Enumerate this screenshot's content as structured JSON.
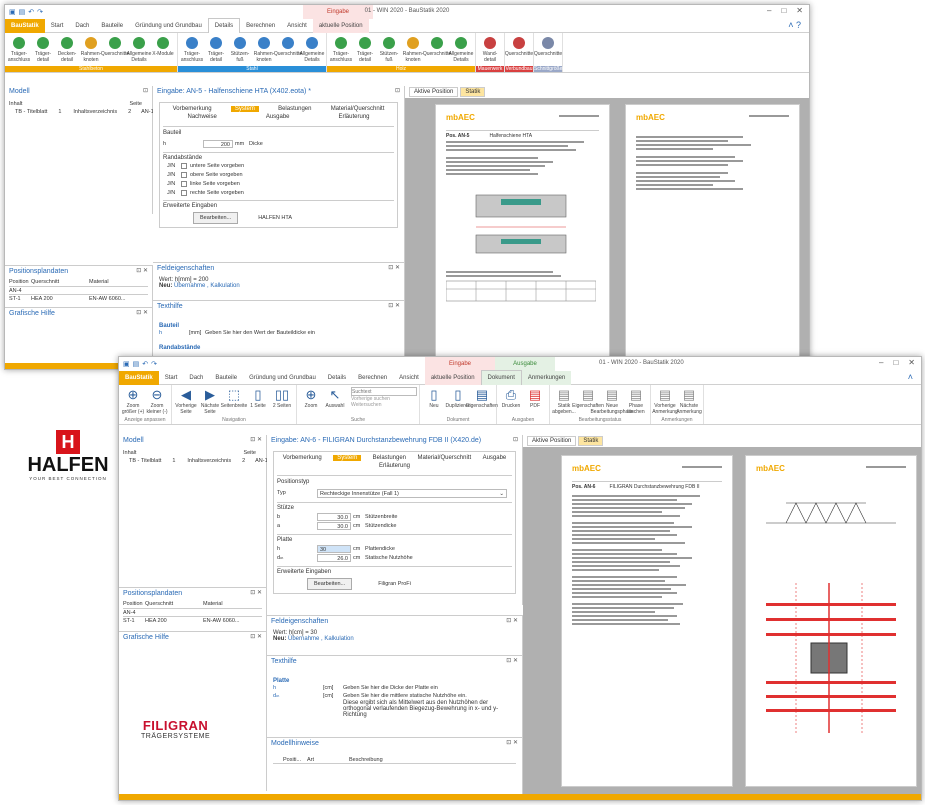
{
  "back": {
    "title": "01 - WIN 2020 - BauStatik 2020",
    "ctx_tab": {
      "line1": "Eingabe",
      "line2": "aktuelle Position"
    },
    "tabs": [
      "BauStatik",
      "Start",
      "Dach",
      "Bauteile",
      "Gründung und Grundbau",
      "Details",
      "Berechnen",
      "Ansicht"
    ],
    "ribbon_groups": [
      {
        "label": "Stahlbeton",
        "color": "#f0a800",
        "buttons": [
          "Träger-anschluss",
          "Träger-detail",
          "Decken-detail",
          "Rahmen-knoten",
          "Querschnitte",
          "Allgemeine Details",
          "X-Module"
        ]
      },
      {
        "label": "Stahl",
        "color": "#2a8fd8",
        "buttons": [
          "Träger-anschluss",
          "Träger-detail",
          "Stützen-fuß",
          "Rahmen-knoten",
          "Querschnitte",
          "Allgemeine Details"
        ]
      },
      {
        "label": "Holz",
        "color": "#f0a800",
        "buttons": [
          "Träger-anschluss",
          "Träger-detail",
          "Stützen-fuß",
          "Rahmen-knoten",
          "Querschnitte",
          "Allgemeine Details"
        ]
      },
      {
        "label": "Mauerwerk",
        "color": "#d94040",
        "buttons": [
          "Wand-detail"
        ]
      },
      {
        "label": "Verbundbau",
        "color": "#d94040",
        "buttons": [
          "Querschnitte"
        ]
      },
      {
        "label": "Schnittgrößen",
        "color": "#9aa8c8",
        "buttons": [
          "Querschnitte"
        ]
      }
    ],
    "model_title": "Modell",
    "model_cols": [
      "Inhalt",
      "Seite"
    ],
    "model_items": [
      {
        "t": "TB - Titelblatt",
        "p": "1"
      },
      {
        "t": "Inhaltsverzeichnis",
        "p": "2"
      },
      {
        "t": "AN-1* - Stahl-Schweißnahtnac...",
        "p": "3"
      },
      {
        "t": "AN-2* - Stahlbeton Eck-Knoten",
        "p": "5"
      },
      {
        "t": "AN-3* - Werkstoffe erzeugen",
        "p": "8"
      },
      {
        "t": "AN-4* - Brandschutzbeikledun...",
        "p": "9"
      },
      {
        "t": "ST-1* - Aluminium-Stütze",
        "p": "10"
      },
      {
        "t": "AN-5* - Halfenschiene HTA",
        "p": "13"
      }
    ],
    "plan_title": "Positionsplandaten",
    "plan_cols": [
      "Position",
      "Querschnitt",
      "Material"
    ],
    "plan_rows": [
      [
        "AN-4",
        "",
        ""
      ],
      [
        "ST-1",
        "HEA 200",
        "EN-AW 6060..."
      ]
    ],
    "help_title": "Grafische Hilfe",
    "input_title": "Eingabe: AN-5 - Halfenschiene HTA (X402.eota) *",
    "input_tabs": [
      "Vorbemerkung",
      "System",
      "Belastungen",
      "Material/Querschnitt",
      "Nachweise",
      "Ausgabe",
      "Erläuterung"
    ],
    "bauteil": "Bauteil",
    "h_label": "h",
    "h_value": "200",
    "h_unit": "mm",
    "h_desc": "Dicke",
    "rand": "Randabstände",
    "rand_rows": [
      [
        "J/N",
        "untere Seite vorgeben"
      ],
      [
        "J/N",
        "obere Seite vorgeben"
      ],
      [
        "J/N",
        "linke Seite vorgeben"
      ],
      [
        "J/N",
        "rechte Seite vorgeben"
      ]
    ],
    "ext": "Erweiterte Eingaben",
    "edit_btn": "Bearbeiten...",
    "ext_val": "HALFEN HTA",
    "field_title": "Feldeigenschaften",
    "field_val": "Wert: h[mm] = 200",
    "field_new": "Neu:",
    "field_links": "Übernahme , Kalkulation",
    "text_title": "Texthilfe",
    "text_key": "Bauteil",
    "text_h": "h",
    "text_unit": "[mm]",
    "text_desc": "Geben Sie hier den Wert der Bauteildicke ein",
    "text_rand": "Randabstände",
    "doc_tabs": [
      "Aktive Position",
      "Statik"
    ],
    "doc_heading": "Pos. AN-5",
    "doc_sub": "Halfenschiene HTA",
    "logo_brand": "mbAEC",
    "halfen": "HALFEN",
    "halfen_sub": "YOUR BEST CONNECTION"
  },
  "front": {
    "title": "01 - WIN 2020 - BauStatik 2020",
    "ctx1": {
      "line1": "Eingabe",
      "line2": "aktuelle Position"
    },
    "ctx2": {
      "line1": "Ausgabe",
      "line2": "Dokument"
    },
    "tabs": [
      "BauStatik",
      "Start",
      "Dach",
      "Bauteile",
      "Gründung und Grundbau",
      "Details",
      "Berechnen",
      "Ansicht",
      "aktuelle Position",
      "Dokument",
      "Anmerkungen"
    ],
    "ribbon": [
      {
        "label": "Anzeige anpassen",
        "buttons": [
          "Zoom größer (+)",
          "Zoom kleiner (-)"
        ]
      },
      {
        "label": "Navigation",
        "buttons": [
          "Vorherige Seite",
          "Nächste Seite",
          "Seitenbreite",
          "1 Seite",
          "2 Seiten"
        ]
      },
      {
        "label": "Suche",
        "buttons": [
          "Zoom",
          "Auswahl"
        ]
      },
      {
        "label": "Dokument",
        "buttons": [
          "Neu",
          "Duplizieren",
          "Eigenschaften"
        ]
      },
      {
        "label": "Ausgaben",
        "buttons": [
          "Drucken",
          "PDF"
        ]
      },
      {
        "label": "Bearbeitungsstatus",
        "buttons": [
          "Statik abgeben...",
          "Eigenschaften",
          "Neue Bearbeitungsphase",
          "Phase löschen"
        ]
      },
      {
        "label": "Anmerkungen",
        "buttons": [
          "Vorherige Anmerkung",
          "Nächste Anmerkung"
        ]
      }
    ],
    "search_placeholder": "Suchtext",
    "search_prev": "Vorherige suchen",
    "search_next": "Weitersuchen",
    "model_title": "Modell",
    "model_cols": [
      "Inhalt",
      "Seite"
    ],
    "model_items": [
      {
        "t": "TB - Titelblatt",
        "p": "1"
      },
      {
        "t": "Inhaltsverzeichnis",
        "p": "2"
      },
      {
        "t": "AN-1 - Stahl-Schweißnahtnac...",
        "p": "3"
      },
      {
        "t": "AN-2 - Stahlbeton Eck-Knoten",
        "p": "5"
      },
      {
        "t": "AN-3 - Werkstoffe erzeugen",
        "p": "8"
      },
      {
        "t": "AN-4 - Brandschutzbekleidung...",
        "p": "9"
      },
      {
        "t": "ST-1 - Aluminium-Stütze",
        "p": "10"
      },
      {
        "t": "AN-5 - Halfenschiene HTA",
        "p": "13"
      },
      {
        "t": "AN-6 - FILIGRAN Durchstanz...",
        "p": "15"
      },
      {
        "t": "System",
        "p": "15"
      }
    ],
    "plan_title": "Positionsplandaten",
    "plan_cols": [
      "Position",
      "Querschnitt",
      "Material"
    ],
    "plan_rows": [
      [
        "AN-4",
        "",
        ""
      ],
      [
        "ST-1",
        "HEA 200",
        "EN-AW 6060..."
      ]
    ],
    "help_title": "Grafische Hilfe",
    "input_title": "Eingabe: AN-6 - FILIGRAN Durchstanzbewehrung FDB II (X420.de)",
    "input_tabs": [
      "Vorbemerkung",
      "System",
      "Belastungen",
      "Material/Querschnitt",
      "Ausgabe",
      "Erläuterung"
    ],
    "pos_type": "Positionstyp",
    "typ_label": "Typ",
    "typ_value": "Rechteckige Innenstütze (Fall 1)",
    "stuetze": "Stütze",
    "b_val": "30.0",
    "b_unit": "cm",
    "b_desc": "Stützenbreite",
    "a_val": "30.0",
    "a_unit": "cm",
    "a_desc": "Stützendicke",
    "platte": "Platte",
    "ph_val": "30",
    "ph_unit": "cm",
    "ph_desc": "Plattendicke",
    "d_val": "26.0",
    "d_unit": "cm",
    "d_desc": "Statische Nutzhöhe",
    "ext": "Erweiterte Eingaben",
    "edit_btn": "Bearbeiten...",
    "ext_val": "Filigran ProFi",
    "field_title": "Feldeigenschaften",
    "field_val": "Wert: h[cm] = 30",
    "field_new": "Neu:",
    "field_links": "Übernahme , Kalkulation",
    "text_title": "Texthilfe",
    "text_key": "Platte",
    "text_rows": [
      {
        "k": "h",
        "u": "[cm]",
        "d": "Geben Sie hier die Dicke der Platte ein"
      },
      {
        "k": "dₘ",
        "u": "[cm]",
        "d": "Geben Sie hier die mittlere statische Nutzhöhe ein."
      }
    ],
    "text_more": "Diese ergibt sich als Mittelwert aus den Nutzhöhen der orthogonal verlaufenden Biegezug-Bewehrung in x- und y-Richtung",
    "notes_title": "Modellhinweise",
    "notes_cols": [
      "Positi...",
      "Art",
      "Beschreibung"
    ],
    "doc_tabs": [
      "Aktive Position",
      "Statik"
    ],
    "doc_heading": "Pos. AN-6",
    "doc_sub": "FILIGRAN Durchstanzbewehrung FDB II",
    "logo_brand": "mbAEC",
    "filigran": "FILIGRAN",
    "filigran_sub": "TRÄGERSYSTEME"
  }
}
